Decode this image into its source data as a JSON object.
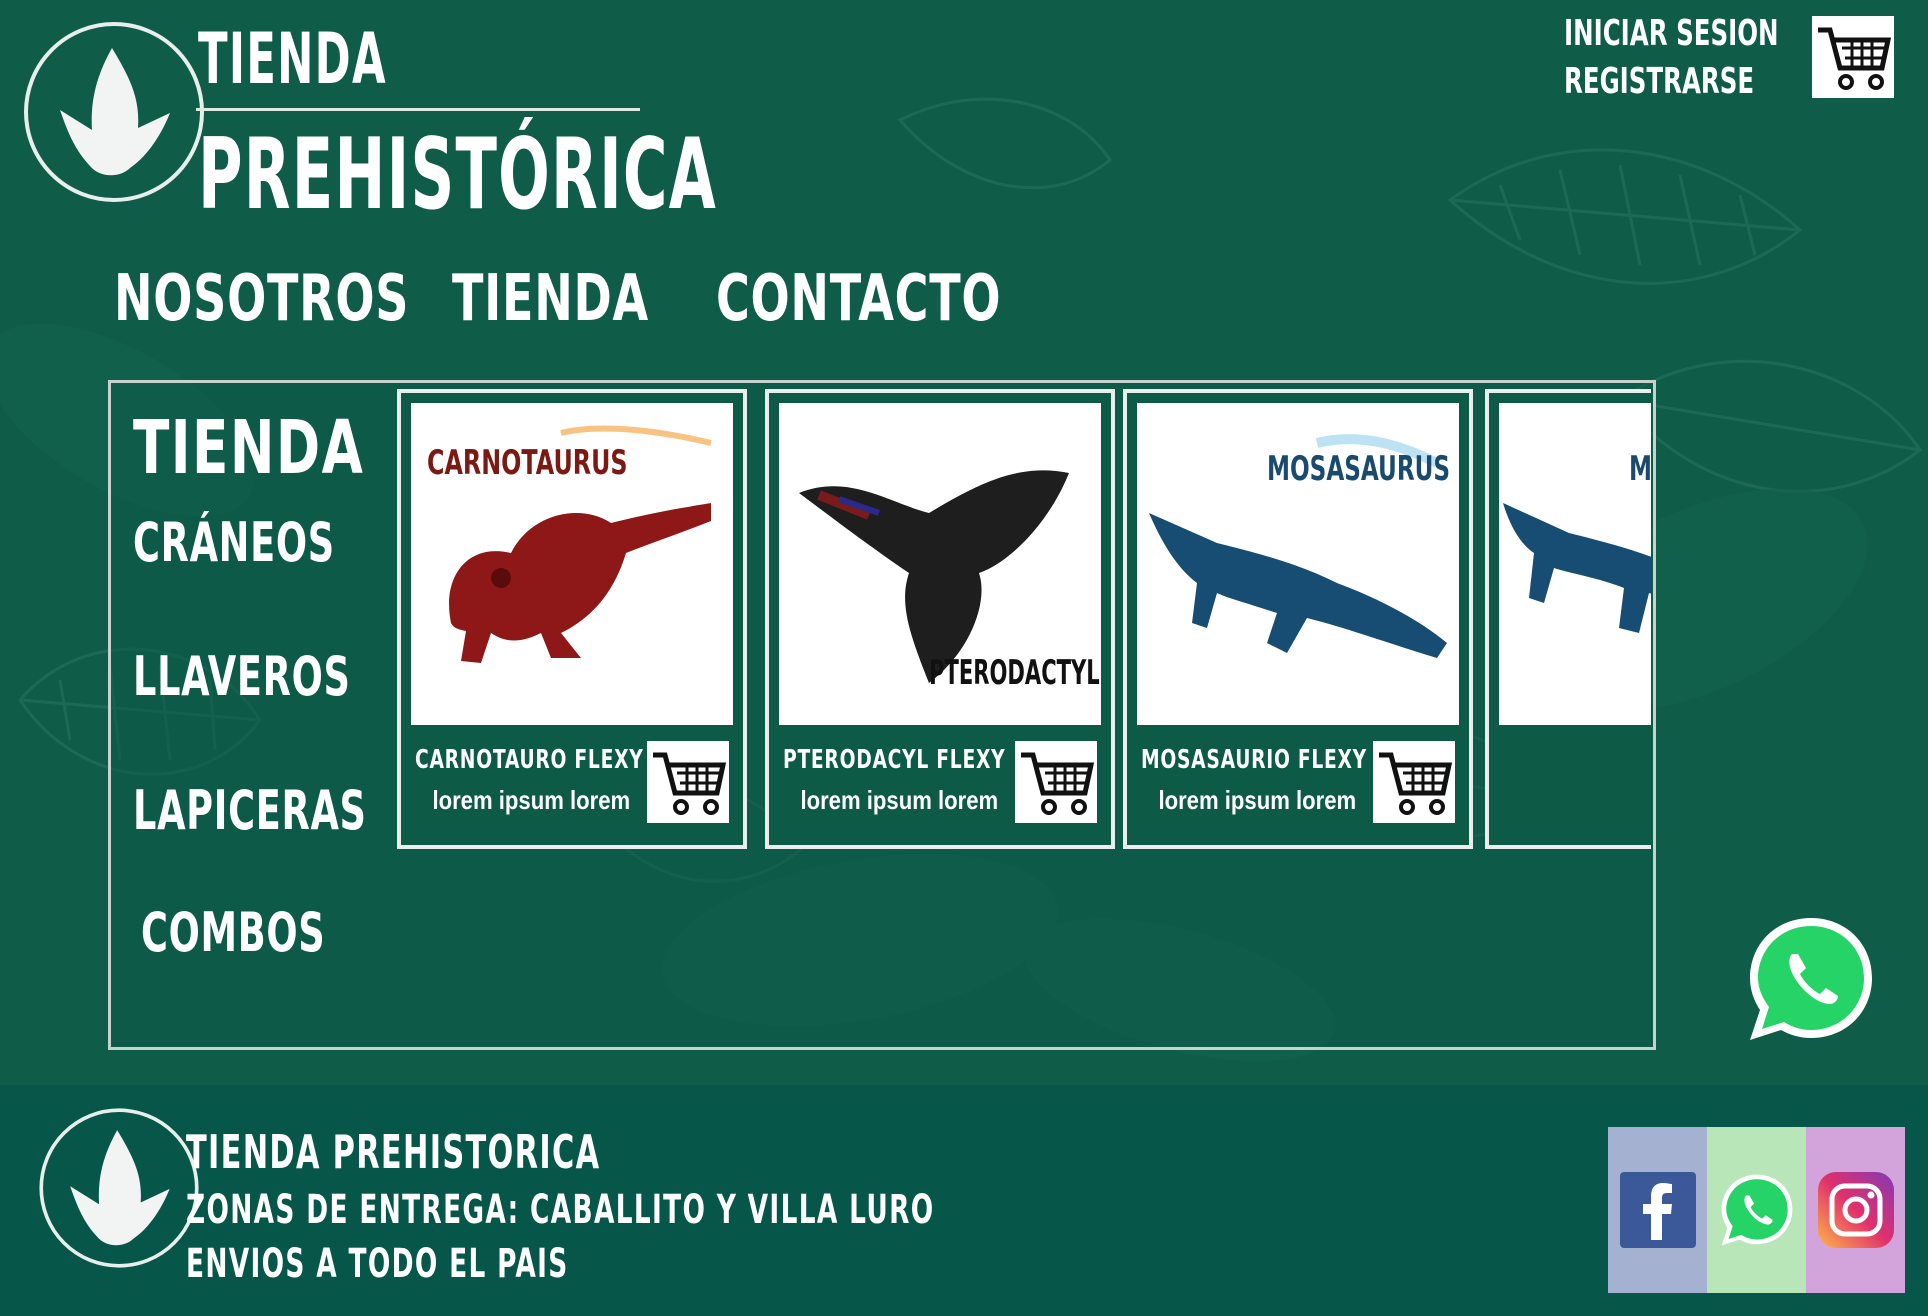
{
  "brand": {
    "line1": "TIENDA",
    "line2": "PREHISTÓRICA"
  },
  "auth": {
    "login": "INICIAR SESION",
    "register": "REGISTRARSE"
  },
  "nav": [
    "NOSOTROS",
    "TIENDA",
    "CONTACTO"
  ],
  "shop": {
    "title": "TIENDA",
    "categories": [
      "CRÁNEOS",
      "LLAVEROS",
      "LAPICERAS",
      "COMBOS"
    ],
    "products": [
      {
        "name": "CARNOTAURO FLEXY",
        "desc": "lorem ipsum lorem",
        "image_label": "CARNOTAURUS",
        "color": "#8e1818"
      },
      {
        "name": "PTERODACYL FLEXY",
        "desc": "lorem ipsum lorem",
        "image_label": "PTERODACTYL",
        "color": "#1e1e1e"
      },
      {
        "name": "MOSASAURIO FLEXY",
        "desc": "lorem ipsum lorem",
        "image_label": "MOSASAURUS",
        "color": "#174d72"
      },
      {
        "name": "",
        "desc": "",
        "image_label": "MO",
        "color": "#174d72"
      }
    ]
  },
  "footer": {
    "name": "TIENDA PREHISTORICA",
    "zones": "ZONAS DE ENTREGA: CABALLITO Y VILLA LURO",
    "shipping": "ENVIOS A TODO EL PAIS"
  },
  "colors": {
    "background": "#0d5a47",
    "footer": "#06574a",
    "facebook": "#3b5998",
    "whatsapp": "#25d366",
    "instagram": "#c13584"
  },
  "icons": [
    "dino-footprint-icon",
    "cart-icon",
    "whatsapp-icon",
    "facebook-icon",
    "instagram-icon"
  ]
}
